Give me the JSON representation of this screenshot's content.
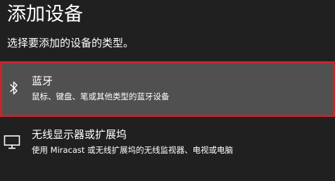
{
  "page": {
    "title": "添加设备",
    "subtitle": "选择要添加的设备的类型。"
  },
  "options": [
    {
      "title": "蓝牙",
      "description": "鼠标、键盘、笔或其他类型的蓝牙设备",
      "icon": "bluetooth-icon",
      "selected": true
    },
    {
      "title": "无线显示器或扩展坞",
      "description": "使用 Miracast 或无线扩展坞的无线监视器、电视或电脑",
      "icon": "monitor-icon",
      "selected": false
    }
  ],
  "colors": {
    "background": "#202020",
    "selected_background": "#505050",
    "selected_border": "#c4262e",
    "text": "#ffffff"
  }
}
